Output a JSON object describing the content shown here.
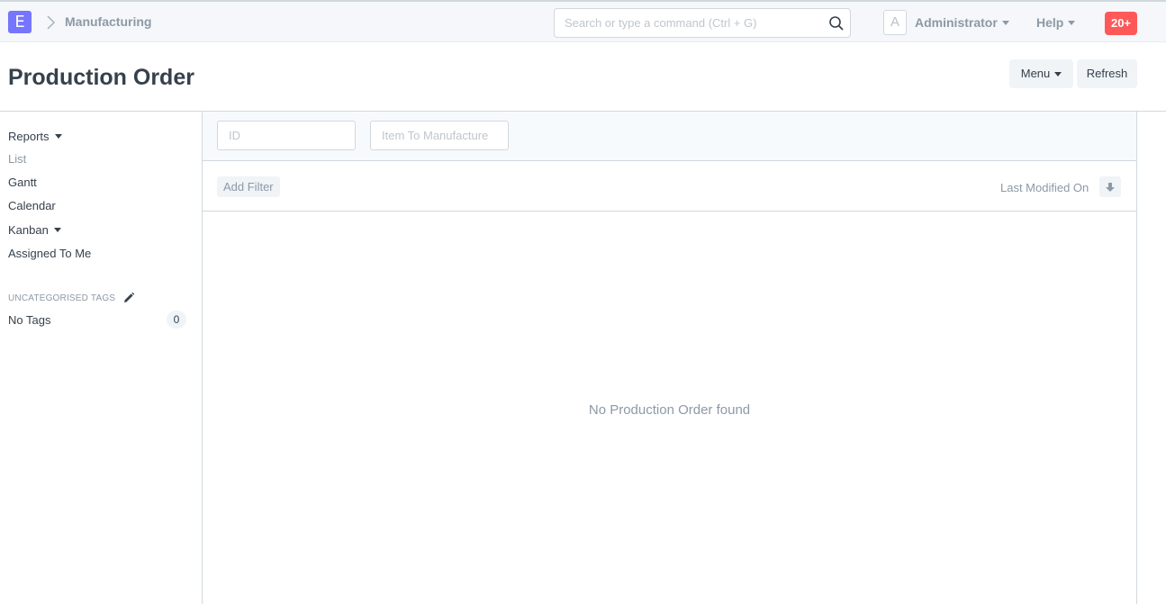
{
  "navbar": {
    "logo_letter": "E",
    "breadcrumb": "Manufacturing",
    "search_placeholder": "Search or type a command (Ctrl + G)",
    "avatar_letter": "A",
    "user_label": "Administrator",
    "help_label": "Help",
    "notification_count": "20+"
  },
  "page": {
    "title": "Production Order",
    "menu_label": "Menu",
    "refresh_label": "Refresh"
  },
  "sidebar": {
    "items": [
      {
        "label": "Reports"
      },
      {
        "label": "List"
      },
      {
        "label": "Gantt"
      },
      {
        "label": "Calendar"
      },
      {
        "label": "Kanban"
      },
      {
        "label": "Assigned To Me"
      }
    ],
    "tags_heading": "Uncategorised Tags",
    "no_tags_label": "No Tags",
    "no_tags_count": "0"
  },
  "filters": {
    "id_placeholder": "ID",
    "item_placeholder": "Item To Manufacture",
    "add_filter_label": "Add Filter",
    "sort_label": "Last Modified On"
  },
  "list": {
    "empty_message": "No Production Order found"
  },
  "colors": {
    "logo": "#7575ff",
    "notification": "#ff5858",
    "muted_text": "#8d99a6"
  }
}
